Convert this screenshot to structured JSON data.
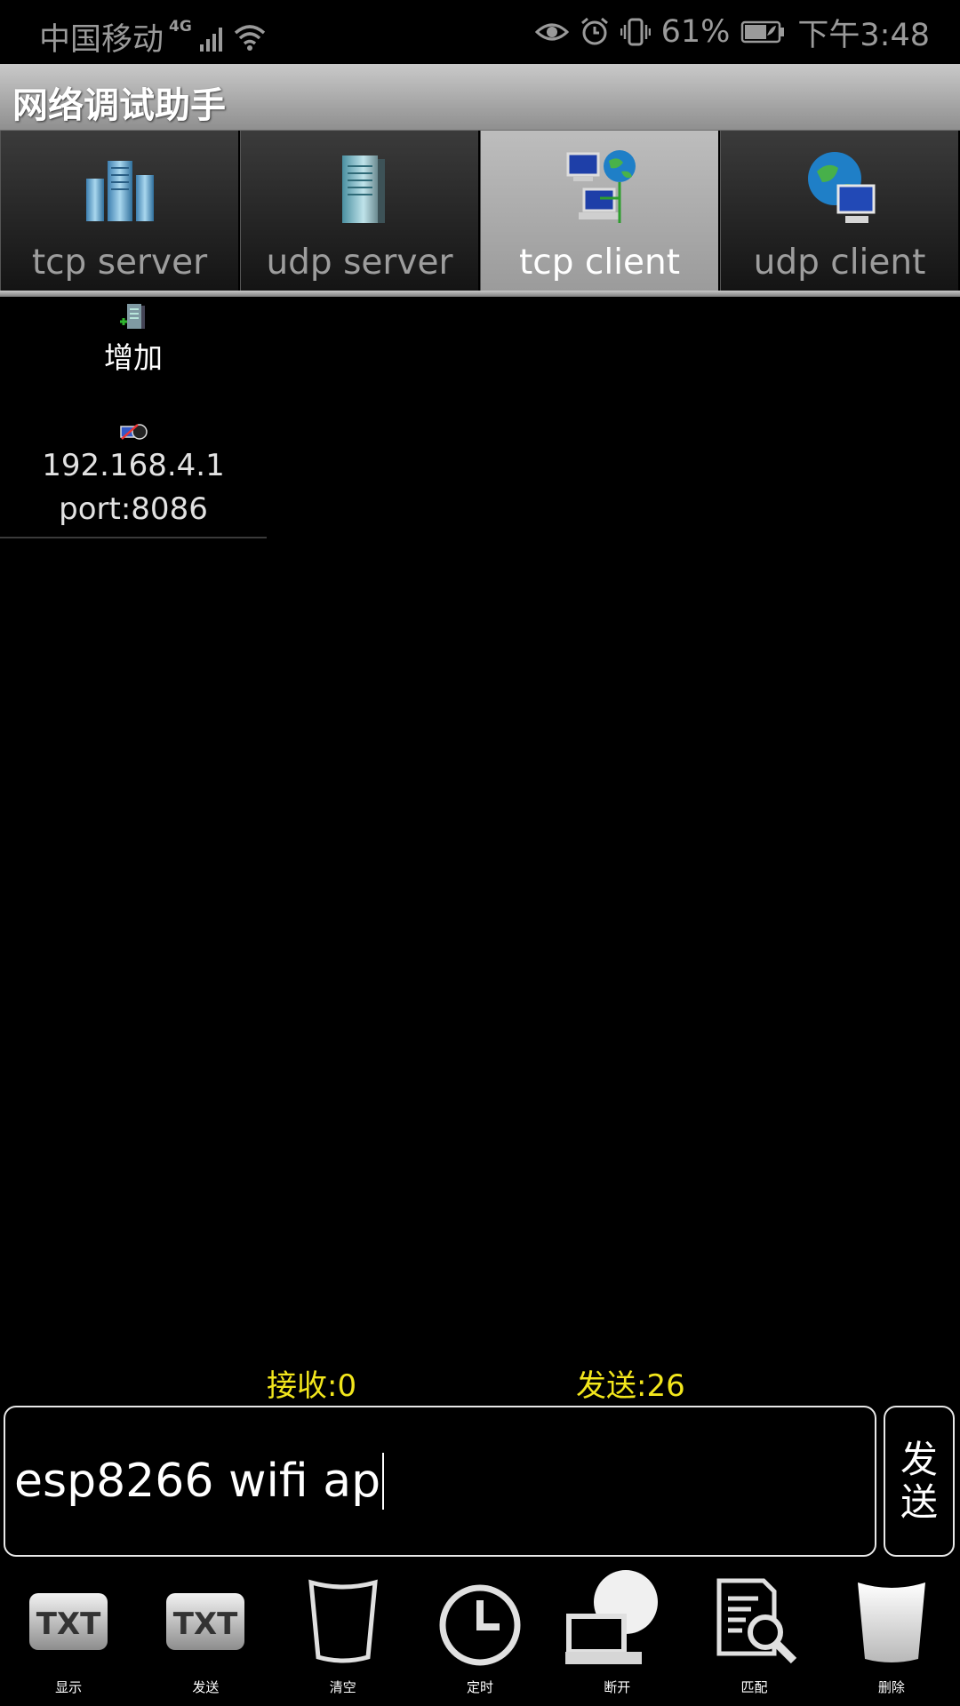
{
  "status_bar": {
    "carrier": "中国移动",
    "network_type": "4G",
    "battery_percent": "61%",
    "time": "下午3:48",
    "icons": [
      "signal-icon",
      "wifi-icon",
      "eye-icon",
      "alarm-icon",
      "vibrate-icon",
      "battery-icon"
    ]
  },
  "app": {
    "title": "网络调试助手"
  },
  "tabs": [
    {
      "label": "tcp server",
      "icon": "server-rack-icon",
      "active": false
    },
    {
      "label": "udp server",
      "icon": "server-tower-icon",
      "active": false
    },
    {
      "label": "tcp client",
      "icon": "network-computers-icon",
      "active": true
    },
    {
      "label": "udp client",
      "icon": "globe-computer-icon",
      "active": false
    }
  ],
  "client_list": {
    "add_label": "增加",
    "connections": [
      {
        "ip": "192.168.4.1",
        "port": "port:8086"
      }
    ]
  },
  "counters": {
    "receive": "接收:0",
    "send": "发送:26"
  },
  "input": {
    "value": "esp8266 wifi ap"
  },
  "send_button": {
    "label": "发送"
  },
  "toolbar": [
    {
      "label": "显示",
      "icon": "txt-display-icon"
    },
    {
      "label": "发送",
      "icon": "txt-send-icon"
    },
    {
      "label": "清空",
      "icon": "clear-cup-icon"
    },
    {
      "label": "定时",
      "icon": "clock-icon"
    },
    {
      "label": "断开",
      "icon": "disconnect-icon"
    },
    {
      "label": "匹配",
      "icon": "document-search-icon"
    },
    {
      "label": "删除",
      "icon": "delete-cup-icon"
    }
  ],
  "colors": {
    "counter_text": "#f2e61c",
    "active_tab": "#b0b0b0",
    "background": "#000000"
  }
}
